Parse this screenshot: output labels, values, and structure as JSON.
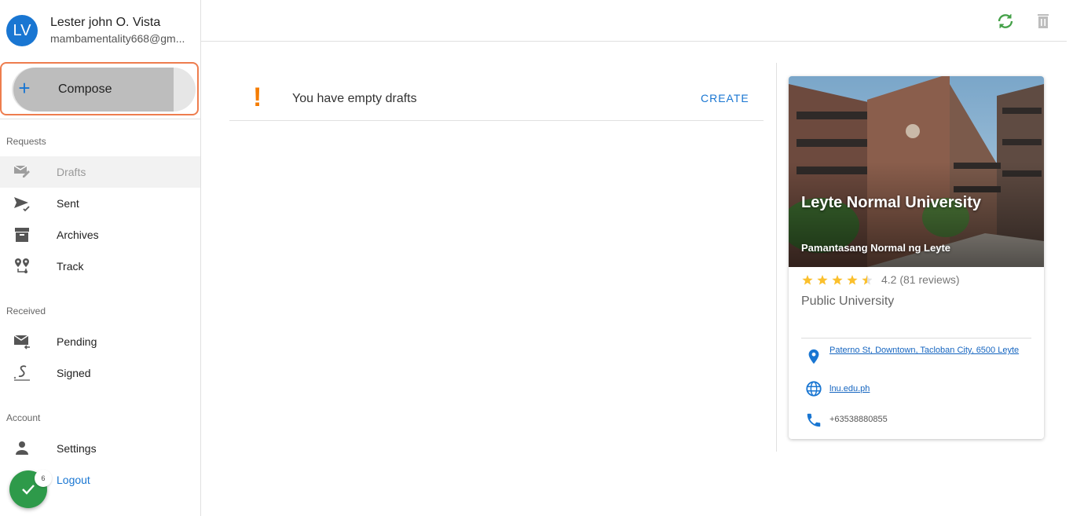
{
  "profile": {
    "initials": "LV",
    "name": "Lester john O. Vista",
    "email": "mambamentality668@gm..."
  },
  "compose": {
    "label": "Compose"
  },
  "sections": {
    "requests": "Requests",
    "received": "Received",
    "account": "Account"
  },
  "nav": {
    "drafts": "Drafts",
    "sent": "Sent",
    "archives": "Archives",
    "track": "Track",
    "pending": "Pending",
    "signed": "Signed",
    "settings": "Settings",
    "logout": "Logout"
  },
  "fab": {
    "badge": "6"
  },
  "main": {
    "empty_message": "You have empty drafts",
    "create_label": "CREATE"
  },
  "card": {
    "title": "Leyte Normal University",
    "subtitle": "Pamantasang Normal ng Leyte",
    "rating": 4.2,
    "rating_text": "4.2 (81 reviews)",
    "type": "Public University",
    "address": "Paterno St, Downtown, Tacloban City, 6500 Leyte",
    "website": "lnu.edu.ph",
    "phone": "+63538880855"
  },
  "colors": {
    "accent": "#1976d2",
    "compose_outline": "#ee7d4e",
    "warning": "#f57c00",
    "refresh": "#43a047",
    "moon": "#f57c00",
    "star": "#fbc02d",
    "fab": "#2e9a4a"
  },
  "icons": {
    "top": [
      "moon-icon",
      "refresh-icon",
      "trash-icon"
    ],
    "nav": [
      "drafts-icon",
      "send-icon",
      "archive-icon",
      "track-icon",
      "pending-mail-icon",
      "signature-icon",
      "person-icon",
      "logout-icon"
    ]
  }
}
